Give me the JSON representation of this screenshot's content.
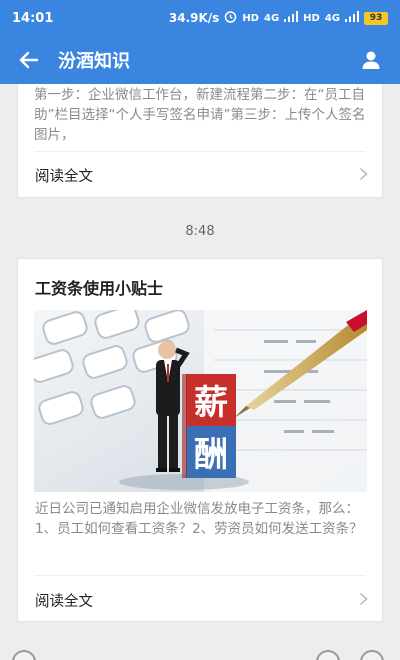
{
  "status_bar": {
    "time": "14:01",
    "network_speed": "34.9K/s",
    "hd1": "HD",
    "signal1": "4G",
    "hd2": "HD",
    "signal2": "4G",
    "battery": "93"
  },
  "app_bar": {
    "title": "汾酒知识"
  },
  "feed": {
    "card1": {
      "excerpt": "第一步：企业微信工作台，新建流程第二步：在“员工自助”栏目选择“个人手写签名申请”第三步：上传个人签名图片，",
      "read_more": "阅读全文"
    },
    "time_label": "8:48",
    "card2": {
      "title": "工资条使用小贴士",
      "cover_text_1": "薪",
      "cover_text_2": "酬",
      "excerpt": "近日公司已通知启用企业微信发放电子工资条，那么：1、员工如何查看工资条？2、劳资员如何发送工资条？",
      "read_more": "阅读全文"
    }
  },
  "colors": {
    "primary": "#3a85e0",
    "battery": "#f3c623",
    "background": "#ededed"
  }
}
